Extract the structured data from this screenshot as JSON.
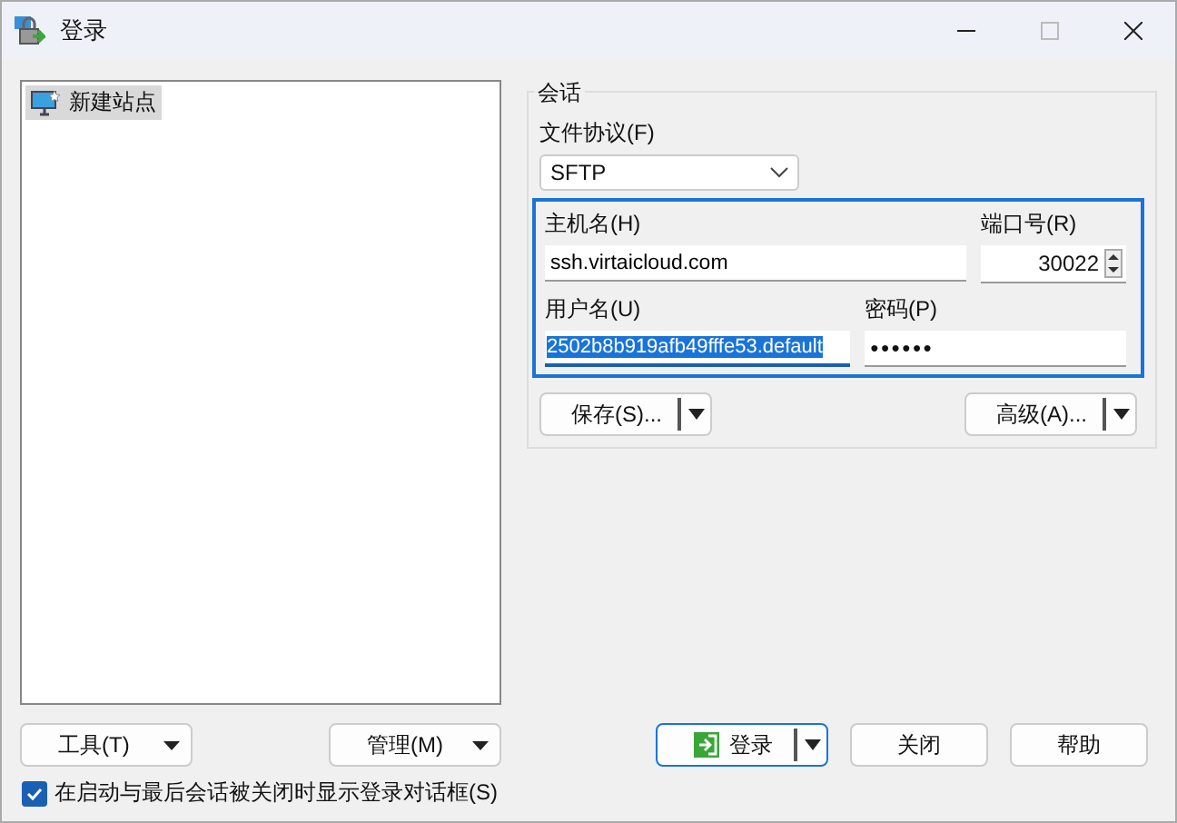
{
  "window": {
    "title": "登录"
  },
  "sites": [
    {
      "label": "新建站点",
      "selected": true
    }
  ],
  "session": {
    "group_label": "会话",
    "protocol": {
      "label": "文件协议(F)",
      "value": "SFTP"
    },
    "host": {
      "label": "主机名(H)",
      "value": "ssh.virtaicloud.com"
    },
    "port": {
      "label": "端口号(R)",
      "value": "30022"
    },
    "user": {
      "label": "用户名(U)",
      "value": "2502b8b919afb49fffe53.default",
      "selected": true
    },
    "password": {
      "label": "密码(P)",
      "value": "●●●●●●"
    },
    "save_button": "保存(S)...",
    "advanced_button": "高级(A)..."
  },
  "tools_button": "工具(T)",
  "manage_button": "管理(M)",
  "login_button": "登录",
  "close_button": "关闭",
  "help_button": "帮助",
  "show_on_startup": {
    "label": "在启动与最后会话被关闭时显示登录对话框(S)",
    "checked": true
  }
}
